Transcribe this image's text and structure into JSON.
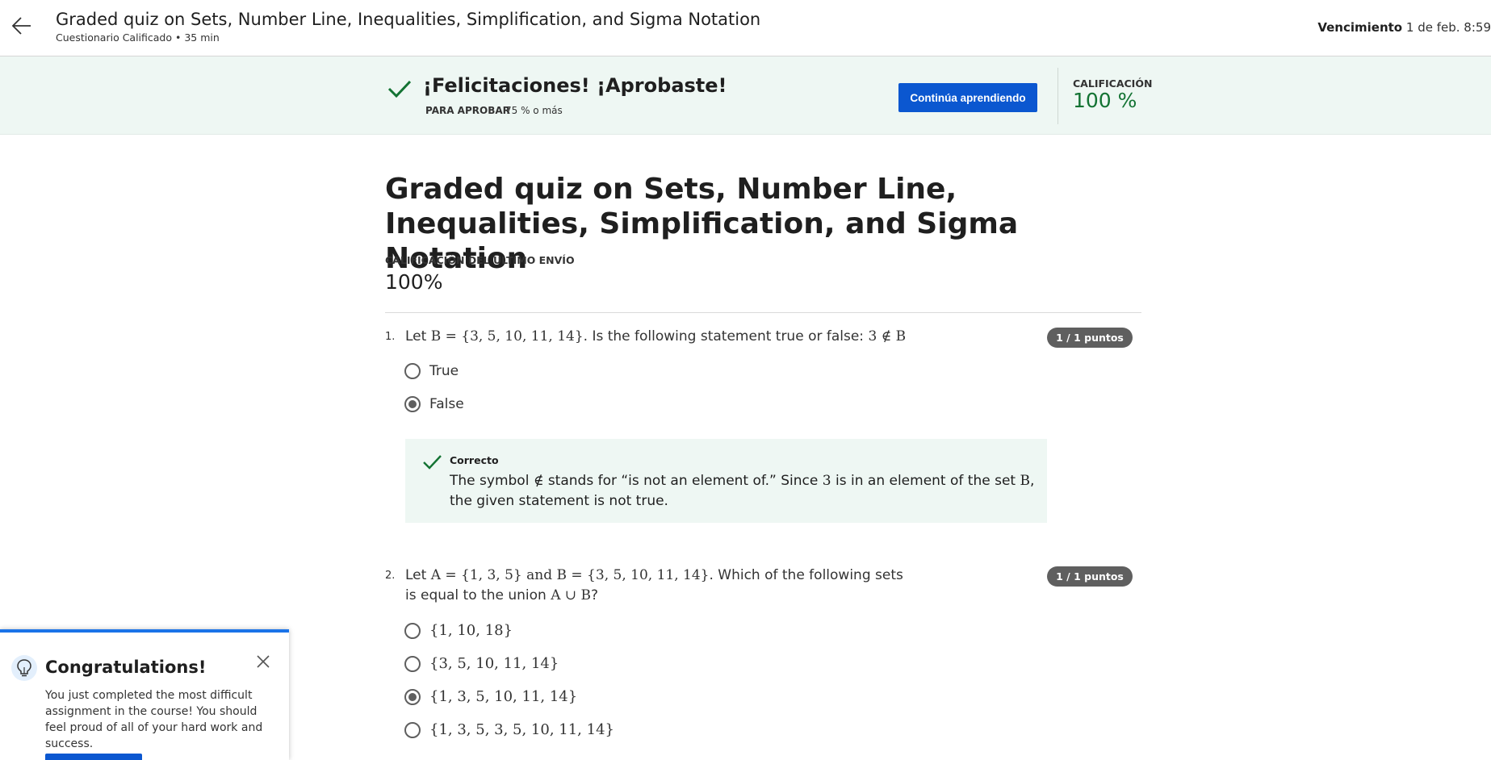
{
  "header": {
    "title": "Graded quiz on Sets, Number Line, Inequalities, Simplification, and Sigma Notation",
    "subtitle": "Cuestionario Calificado • 35 min",
    "due_label": "Vencimiento",
    "due_value": "1 de feb. 8:59"
  },
  "banner": {
    "title": "¡Felicitaciones! ¡Aprobaste!",
    "pass_label": "PARA APROBAR",
    "pass_value": "75 % o más",
    "continue_label": "Continúa aprendiendo",
    "grade_label": "CALIFICACIÓN",
    "grade_value": "100 %"
  },
  "quiz": {
    "title": "Graded quiz on Sets, Number Line, Inequalities, Simplification, and Sigma Notation",
    "last_grade_label": "CALIFICACIÓN DEL ÚLTIMO ENVÍO",
    "last_grade_value": "100%"
  },
  "questions": [
    {
      "number": "1.",
      "parts": [
        "Let ",
        "B = {3, 5, 10, 11, 14}",
        ". Is the following statement true or false: ",
        "3 ∉ B"
      ],
      "points": "1 / 1 puntos",
      "options": [
        {
          "label": "True",
          "selected": false
        },
        {
          "label": "False",
          "selected": true
        }
      ],
      "feedback": {
        "title": "Correcto",
        "parts": [
          "The symbol ",
          "∉",
          " stands for “is not an element of.” Since ",
          "3",
          " is in an element of the set ",
          "B",
          ", the given statement is not true."
        ]
      }
    },
    {
      "number": "2.",
      "parts": [
        "Let ",
        "A = {1, 3, 5}",
        " and ",
        "B = {3, 5, 10, 11, 14}",
        ". Which of the following sets is equal to the union ",
        "A ∪ B",
        "?"
      ],
      "points": "1 / 1 puntos",
      "options": [
        {
          "label": "{1, 10, 18}",
          "selected": false
        },
        {
          "label": "{3, 5, 10, 11, 14}",
          "selected": false
        },
        {
          "label": "{1, 3, 5, 10, 11, 14}",
          "selected": true
        },
        {
          "label": "{1, 3, 5, 3, 5, 10, 11, 14}",
          "selected": false
        }
      ]
    }
  ],
  "popup": {
    "title": "Congratulations!",
    "text": "You just completed the most difficult assignment in the course! You should feel proud of all of your hard work and success."
  },
  "colors": {
    "accent_blue": "#0b57d0",
    "success_green": "#137333",
    "banner_bg": "#eef7f3",
    "points_badge": "#5f5f5f"
  },
  "icons": [
    "back-arrow-icon",
    "check-icon",
    "lightbulb-icon",
    "close-icon"
  ]
}
